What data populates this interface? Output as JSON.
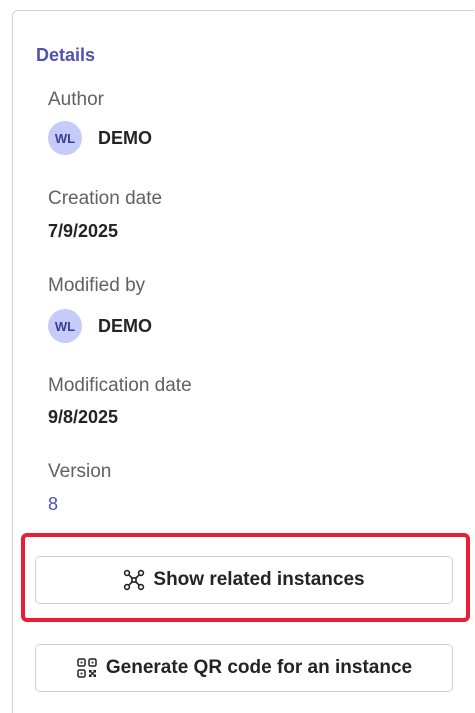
{
  "details": {
    "title": "Details",
    "author": {
      "label": "Author",
      "initials": "WL",
      "name": "DEMO"
    },
    "creation_date": {
      "label": "Creation date",
      "value": "7/9/2025"
    },
    "modified_by": {
      "label": "Modified by",
      "initials": "WL",
      "name": "DEMO"
    },
    "modification_date": {
      "label": "Modification date",
      "value": "9/8/2025"
    },
    "version": {
      "label": "Version",
      "value": "8"
    }
  },
  "actions": {
    "show_related_label": "Show related instances",
    "generate_qr_label": "Generate QR code for an instance"
  },
  "colors": {
    "accent": "#4f52b2",
    "highlight": "#ea1c36",
    "avatar_bg": "#c5cbfa"
  },
  "icons": {
    "show_related": "network-nodes-icon",
    "generate_qr": "qr-code-icon"
  }
}
